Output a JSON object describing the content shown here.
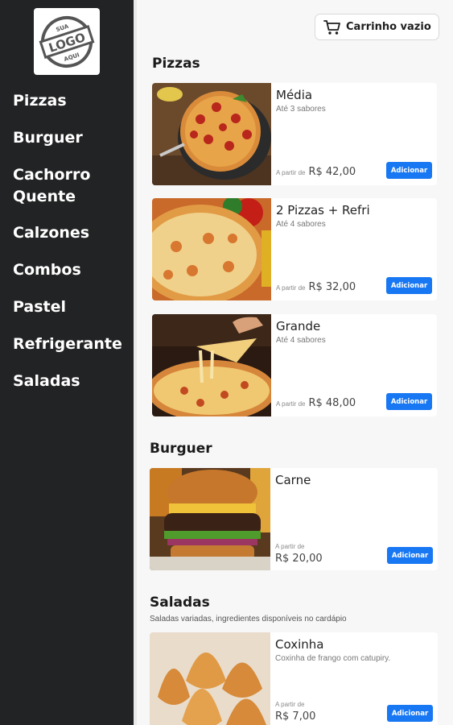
{
  "logo": {
    "text_top": "SUA",
    "text_main": "LOGO",
    "text_bottom": "AQUI"
  },
  "sidebar": {
    "items": [
      {
        "label": "Pizzas"
      },
      {
        "label": "Burguer"
      },
      {
        "label": "Cachorro Quente"
      },
      {
        "label": "Calzones"
      },
      {
        "label": "Combos"
      },
      {
        "label": "Pastel"
      },
      {
        "label": "Refrigerante"
      },
      {
        "label": "Saladas"
      }
    ]
  },
  "cart": {
    "label": "Carrinho vazio",
    "icon": "cart-icon"
  },
  "sections": {
    "pizzas": {
      "title": "Pizzas",
      "items": [
        {
          "name": "Média",
          "desc": "Até 3 sabores",
          "from": "A partir de",
          "price": "R$ 42,00",
          "button": "Adicionar",
          "image": "pizza-pepperoni"
        },
        {
          "name": "2 Pizzas + Refri",
          "desc": "Até 4 sabores",
          "from": "A partir de",
          "price": "R$ 32,00",
          "button": "Adicionar",
          "image": "pizza-cheese"
        },
        {
          "name": "Grande",
          "desc": "Até 4 sabores",
          "from": "A partir de",
          "price": "R$ 48,00",
          "button": "Adicionar",
          "image": "pizza-slice"
        }
      ]
    },
    "burguer": {
      "title": "Burguer",
      "items": [
        {
          "name": "Carne",
          "from": "A partir de",
          "price": "R$ 20,00",
          "button": "Adicionar",
          "image": "burger"
        }
      ]
    },
    "saladas": {
      "title": "Saladas",
      "subtitle": "Saladas variadas, ingredientes disponíveis no cardápio",
      "items": [
        {
          "name": "Coxinha",
          "desc": "Coxinha de frango com catupiry.",
          "from": "A partir de",
          "price": "R$ 7,00",
          "button": "Adicionar",
          "image": "coxinha"
        }
      ]
    }
  },
  "colors": {
    "sidebar_bg": "#222324",
    "accent": "#1877f2",
    "page_bg": "#f7f7f7"
  }
}
